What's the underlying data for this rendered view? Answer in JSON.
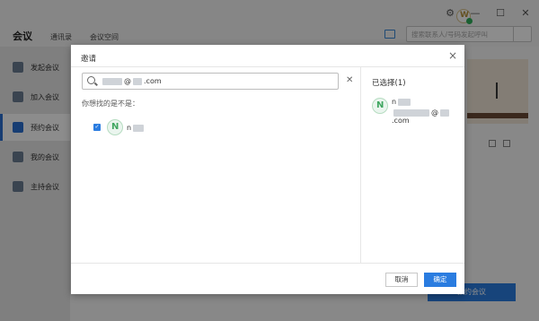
{
  "app": {
    "tabs": [
      "会议",
      "通讯录",
      "会议空间"
    ],
    "avatar_letter": "W",
    "window_controls": [
      "⚙",
      "—",
      "☐",
      "✕"
    ],
    "search_placeholder": "搜索联系人/号码发起呼叫"
  },
  "sidebar": {
    "items": [
      {
        "label": "发起会议",
        "icon": "video-call-icon"
      },
      {
        "label": "加入会议",
        "icon": "join-icon"
      },
      {
        "label": "预约会议",
        "icon": "calendar-icon",
        "active": true
      },
      {
        "label": "我的会议",
        "icon": "my-meeting-icon"
      },
      {
        "label": "主持会议",
        "icon": "host-icon"
      }
    ]
  },
  "main": {
    "schedule_button": "预约会议"
  },
  "dialog": {
    "title": "邀请",
    "close": "×",
    "search_value_at": "@",
    "search_value_domain": ".com",
    "clear": "✕",
    "suggest_label": "你想找的是不是：",
    "contact": {
      "avatar": "N",
      "name_prefix": "n",
      "checked": true
    },
    "selected_header": "已选择(1)",
    "selected": {
      "avatar": "N",
      "name_prefix": "n",
      "email_at": "@",
      "email_domain": ".com"
    },
    "cancel_label": "取消",
    "ok_label": "确定"
  },
  "colors": {
    "accent": "#2a7ce0",
    "avatar_green": "#3fa660"
  }
}
